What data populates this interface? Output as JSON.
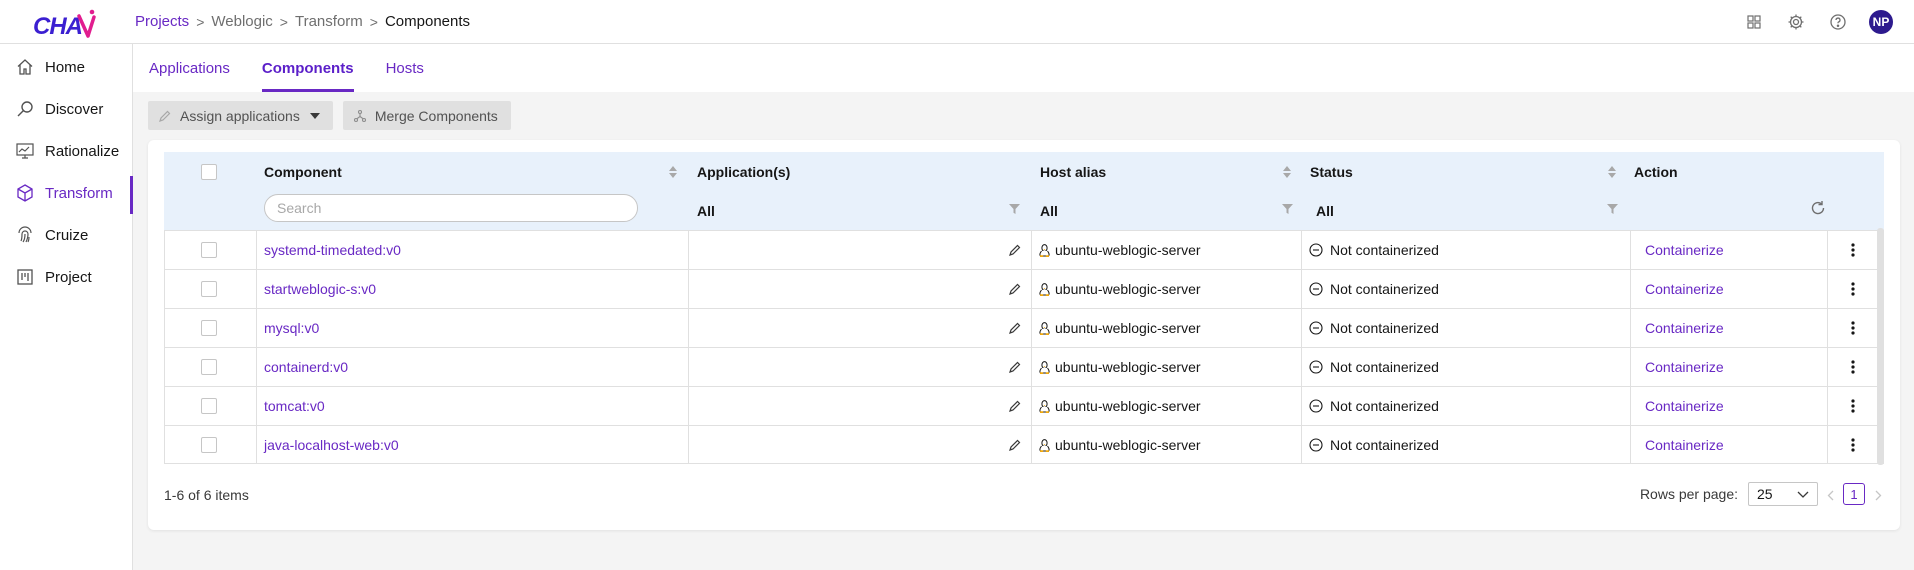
{
  "app": {
    "logo_text": "CHAI",
    "brand_color": "#6929c4"
  },
  "breadcrumb": [
    {
      "label": "Projects",
      "link": true
    },
    {
      "label": "Weblogic",
      "link": false
    },
    {
      "label": "Transform",
      "link": false
    },
    {
      "label": "Components",
      "link": false,
      "current": true
    }
  ],
  "top_icons": [
    "app-switcher-icon",
    "gear-icon",
    "help-icon"
  ],
  "user": {
    "initials": "NP"
  },
  "sidebar": {
    "items": [
      {
        "label": "Home",
        "icon": "home-icon",
        "active": false
      },
      {
        "label": "Discover",
        "icon": "discover-icon",
        "active": false
      },
      {
        "label": "Rationalize",
        "icon": "rationalize-icon",
        "active": false
      },
      {
        "label": "Transform",
        "icon": "cube-icon",
        "active": true
      },
      {
        "label": "Cruize",
        "icon": "fingerprint-icon",
        "active": false
      },
      {
        "label": "Project",
        "icon": "kanban-icon",
        "active": false
      }
    ]
  },
  "tabs": [
    {
      "label": "Applications",
      "active": false
    },
    {
      "label": "Components",
      "active": true
    },
    {
      "label": "Hosts",
      "active": false
    }
  ],
  "toolbar": {
    "assign_label": "Assign applications",
    "merge_label": "Merge Components"
  },
  "table": {
    "headers": {
      "component": "Component",
      "applications": "Application(s)",
      "host_alias": "Host alias",
      "status": "Status",
      "action": "Action"
    },
    "filters": {
      "search_placeholder": "Search",
      "applications": "All",
      "host_alias": "All",
      "status": "All"
    },
    "rows": [
      {
        "component": "systemd-timedated:v0",
        "host": "ubuntu-weblogic-server",
        "status": "Not containerized",
        "action": "Containerize"
      },
      {
        "component": "startweblogic-s:v0",
        "host": "ubuntu-weblogic-server",
        "status": "Not containerized",
        "action": "Containerize"
      },
      {
        "component": "mysql:v0",
        "host": "ubuntu-weblogic-server",
        "status": "Not containerized",
        "action": "Containerize"
      },
      {
        "component": "containerd:v0",
        "host": "ubuntu-weblogic-server",
        "status": "Not containerized",
        "action": "Containerize"
      },
      {
        "component": "tomcat:v0",
        "host": "ubuntu-weblogic-server",
        "status": "Not containerized",
        "action": "Containerize"
      },
      {
        "component": "java-localhost-web:v0",
        "host": "ubuntu-weblogic-server",
        "status": "Not containerized",
        "action": "Containerize"
      }
    ]
  },
  "pagination": {
    "summary": "1-6 of 6 items",
    "rows_per_page_label": "Rows per page:",
    "rows_per_page_value": "25",
    "current_page": "1"
  }
}
